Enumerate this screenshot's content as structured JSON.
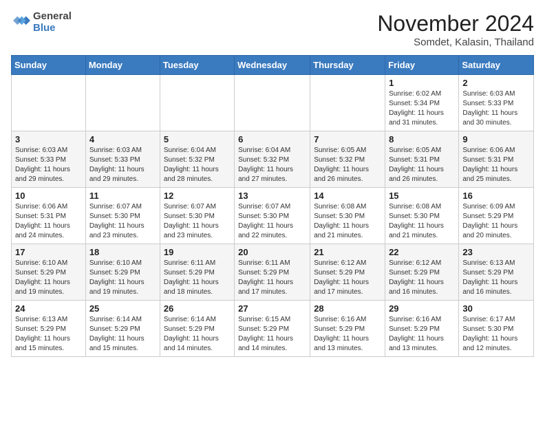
{
  "header": {
    "logo_line1": "General",
    "logo_line2": "Blue",
    "month_year": "November 2024",
    "location": "Somdet, Kalasin, Thailand"
  },
  "weekdays": [
    "Sunday",
    "Monday",
    "Tuesday",
    "Wednesday",
    "Thursday",
    "Friday",
    "Saturday"
  ],
  "weeks": [
    [
      {
        "day": "",
        "info": ""
      },
      {
        "day": "",
        "info": ""
      },
      {
        "day": "",
        "info": ""
      },
      {
        "day": "",
        "info": ""
      },
      {
        "day": "",
        "info": ""
      },
      {
        "day": "1",
        "info": "Sunrise: 6:02 AM\nSunset: 5:34 PM\nDaylight: 11 hours and 31 minutes."
      },
      {
        "day": "2",
        "info": "Sunrise: 6:03 AM\nSunset: 5:33 PM\nDaylight: 11 hours and 30 minutes."
      }
    ],
    [
      {
        "day": "3",
        "info": "Sunrise: 6:03 AM\nSunset: 5:33 PM\nDaylight: 11 hours and 29 minutes."
      },
      {
        "day": "4",
        "info": "Sunrise: 6:03 AM\nSunset: 5:33 PM\nDaylight: 11 hours and 29 minutes."
      },
      {
        "day": "5",
        "info": "Sunrise: 6:04 AM\nSunset: 5:32 PM\nDaylight: 11 hours and 28 minutes."
      },
      {
        "day": "6",
        "info": "Sunrise: 6:04 AM\nSunset: 5:32 PM\nDaylight: 11 hours and 27 minutes."
      },
      {
        "day": "7",
        "info": "Sunrise: 6:05 AM\nSunset: 5:32 PM\nDaylight: 11 hours and 26 minutes."
      },
      {
        "day": "8",
        "info": "Sunrise: 6:05 AM\nSunset: 5:31 PM\nDaylight: 11 hours and 26 minutes."
      },
      {
        "day": "9",
        "info": "Sunrise: 6:06 AM\nSunset: 5:31 PM\nDaylight: 11 hours and 25 minutes."
      }
    ],
    [
      {
        "day": "10",
        "info": "Sunrise: 6:06 AM\nSunset: 5:31 PM\nDaylight: 11 hours and 24 minutes."
      },
      {
        "day": "11",
        "info": "Sunrise: 6:07 AM\nSunset: 5:30 PM\nDaylight: 11 hours and 23 minutes."
      },
      {
        "day": "12",
        "info": "Sunrise: 6:07 AM\nSunset: 5:30 PM\nDaylight: 11 hours and 23 minutes."
      },
      {
        "day": "13",
        "info": "Sunrise: 6:07 AM\nSunset: 5:30 PM\nDaylight: 11 hours and 22 minutes."
      },
      {
        "day": "14",
        "info": "Sunrise: 6:08 AM\nSunset: 5:30 PM\nDaylight: 11 hours and 21 minutes."
      },
      {
        "day": "15",
        "info": "Sunrise: 6:08 AM\nSunset: 5:30 PM\nDaylight: 11 hours and 21 minutes."
      },
      {
        "day": "16",
        "info": "Sunrise: 6:09 AM\nSunset: 5:29 PM\nDaylight: 11 hours and 20 minutes."
      }
    ],
    [
      {
        "day": "17",
        "info": "Sunrise: 6:10 AM\nSunset: 5:29 PM\nDaylight: 11 hours and 19 minutes."
      },
      {
        "day": "18",
        "info": "Sunrise: 6:10 AM\nSunset: 5:29 PM\nDaylight: 11 hours and 19 minutes."
      },
      {
        "day": "19",
        "info": "Sunrise: 6:11 AM\nSunset: 5:29 PM\nDaylight: 11 hours and 18 minutes."
      },
      {
        "day": "20",
        "info": "Sunrise: 6:11 AM\nSunset: 5:29 PM\nDaylight: 11 hours and 17 minutes."
      },
      {
        "day": "21",
        "info": "Sunrise: 6:12 AM\nSunset: 5:29 PM\nDaylight: 11 hours and 17 minutes."
      },
      {
        "day": "22",
        "info": "Sunrise: 6:12 AM\nSunset: 5:29 PM\nDaylight: 11 hours and 16 minutes."
      },
      {
        "day": "23",
        "info": "Sunrise: 6:13 AM\nSunset: 5:29 PM\nDaylight: 11 hours and 16 minutes."
      }
    ],
    [
      {
        "day": "24",
        "info": "Sunrise: 6:13 AM\nSunset: 5:29 PM\nDaylight: 11 hours and 15 minutes."
      },
      {
        "day": "25",
        "info": "Sunrise: 6:14 AM\nSunset: 5:29 PM\nDaylight: 11 hours and 15 minutes."
      },
      {
        "day": "26",
        "info": "Sunrise: 6:14 AM\nSunset: 5:29 PM\nDaylight: 11 hours and 14 minutes."
      },
      {
        "day": "27",
        "info": "Sunrise: 6:15 AM\nSunset: 5:29 PM\nDaylight: 11 hours and 14 minutes."
      },
      {
        "day": "28",
        "info": "Sunrise: 6:16 AM\nSunset: 5:29 PM\nDaylight: 11 hours and 13 minutes."
      },
      {
        "day": "29",
        "info": "Sunrise: 6:16 AM\nSunset: 5:29 PM\nDaylight: 11 hours and 13 minutes."
      },
      {
        "day": "30",
        "info": "Sunrise: 6:17 AM\nSunset: 5:30 PM\nDaylight: 11 hours and 12 minutes."
      }
    ]
  ]
}
